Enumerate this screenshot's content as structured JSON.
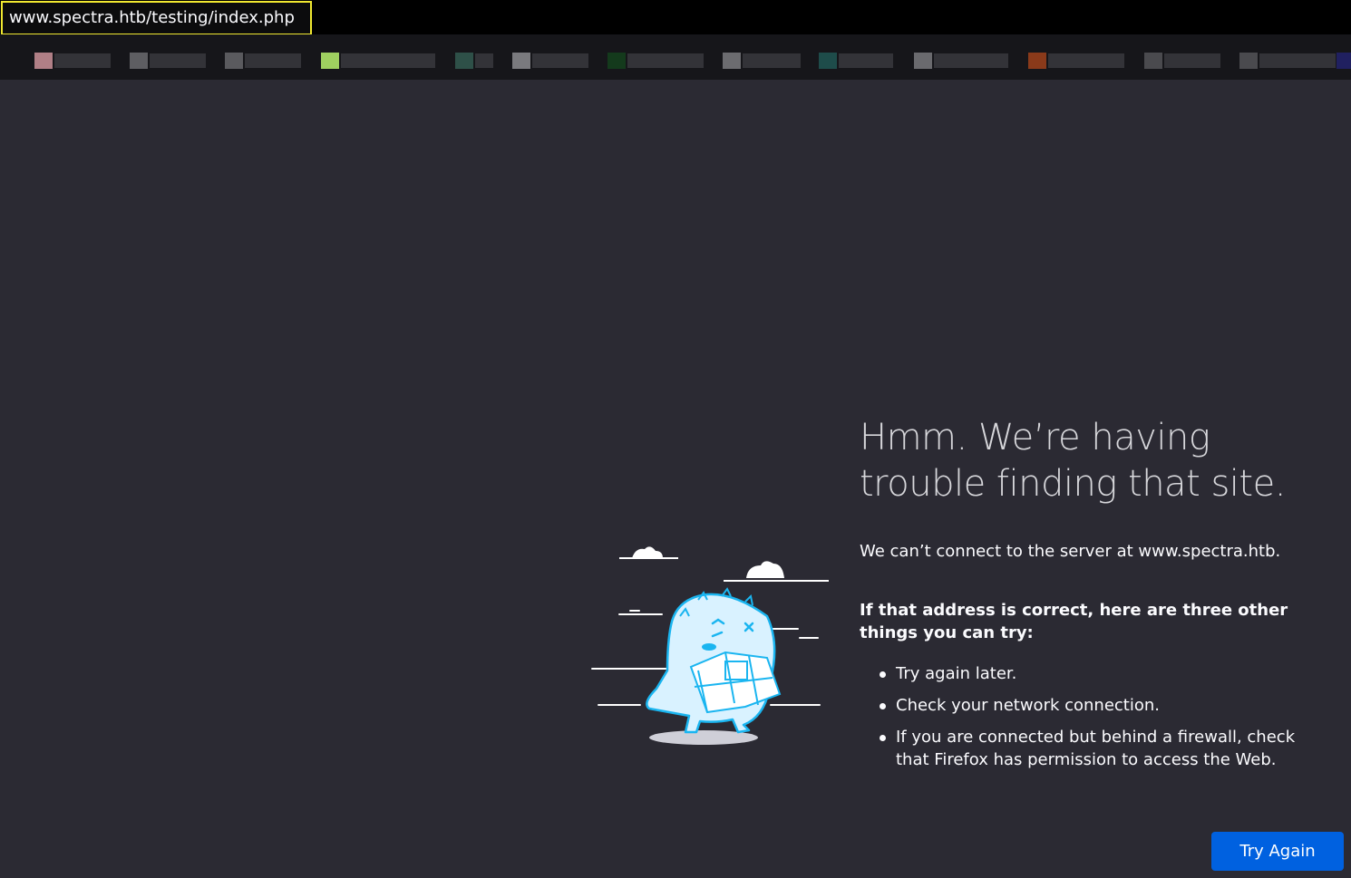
{
  "browser": {
    "url": "www.spectra.htb/testing/index.php"
  },
  "error_page": {
    "title": "Hmm. We’re having trouble finding that site.",
    "description": "We can’t connect to the server at www.spectra.htb.",
    "suggestions_heading": "If that address is correct, here are three other things you can try:",
    "suggestions": [
      "Try again later.",
      "Check your network connection.",
      "If you are connected but behind a firewall, check that Firefox has permission to access the Web."
    ],
    "try_again_label": "Try Again"
  },
  "colors": {
    "page_background": "#2b2a33",
    "url_highlight": "#f0e830",
    "button": "#0061e0",
    "illustration_accent": "#1ab5f0"
  }
}
